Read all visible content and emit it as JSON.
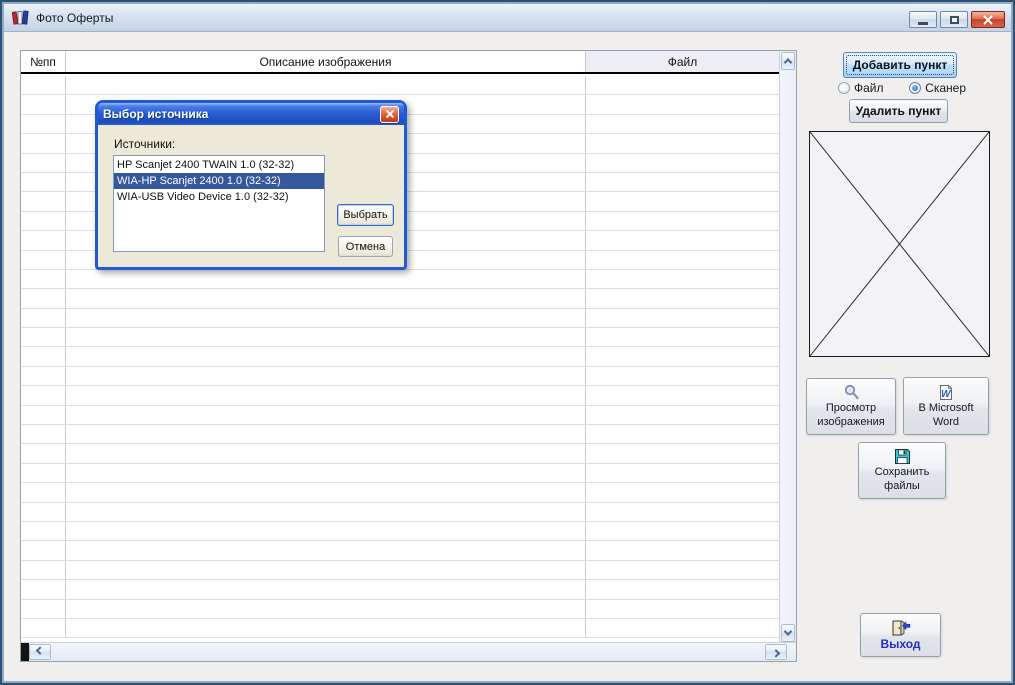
{
  "window": {
    "title": "Фото Оферты",
    "icon": "books-icon",
    "controls": {
      "minimize": "minimize",
      "maximize": "maximize",
      "close": "close"
    }
  },
  "table": {
    "columns": [
      "№пп",
      "Описание изображения",
      "Файл"
    ],
    "row_count": 29,
    "rows": []
  },
  "panel": {
    "add_button_label": "Добавить пункт",
    "radios": [
      {
        "label": "Файл",
        "checked": false
      },
      {
        "label": "Сканер",
        "checked": true
      }
    ],
    "delete_button_label": "Удалить пункт",
    "view_button": {
      "line1": "Просмотр",
      "line2": "изображения",
      "icon": "magnifier-icon"
    },
    "word_button": {
      "line1": "В Microsoft",
      "line2": "Word",
      "icon": "word-icon"
    },
    "save_button": {
      "line1": "Сохранить",
      "line2": "файлы",
      "icon": "floppy-icon"
    },
    "exit_button": {
      "label": "Выход",
      "icon": "exit-door-icon"
    }
  },
  "dialog": {
    "title": "Выбор источника",
    "sources_label": "Источники:",
    "items": [
      "HP Scanjet 2400 TWAIN 1.0 (32-32)",
      "WIA-HP Scanjet 2400 1.0 (32-32)",
      "WIA-USB Video Device 1.0 (32-32)"
    ],
    "selected_index": 1,
    "select_button_label": "Выбрать",
    "cancel_button_label": "Отмена"
  },
  "colors": {
    "selection": "#35589d",
    "dialog_border": "#2159d0",
    "dialog_body": "#ece9d8",
    "client_bg": "#f0efee",
    "exit_text": "#1f2fbb"
  }
}
